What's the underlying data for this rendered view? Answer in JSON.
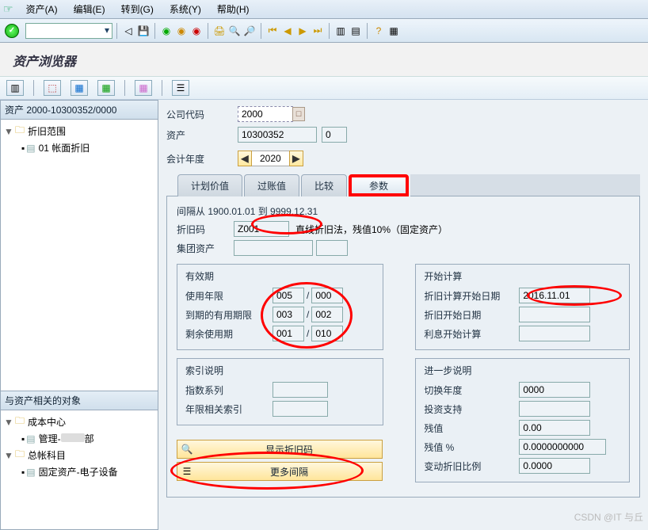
{
  "menubar": {
    "items": [
      {
        "label": "资产(A)"
      },
      {
        "label": "编辑(E)"
      },
      {
        "label": "转到(G)"
      },
      {
        "label": "系统(Y)"
      },
      {
        "label": "帮助(H)"
      }
    ]
  },
  "title": "资产浏览器",
  "left_tree": {
    "header": "资产 2000-10300352/0000",
    "root": {
      "label": "折旧范围"
    },
    "child": {
      "label": "01  帐面折旧"
    }
  },
  "left_tree2": {
    "header": "与资产相关的对象",
    "node1": {
      "label": "成本中心"
    },
    "node1_child": {
      "prefix": "管理-",
      "suffix": "部"
    },
    "node2": {
      "label": "总帐科目"
    },
    "node2_child": {
      "label": "固定资产-电子设备"
    }
  },
  "form": {
    "company_label": "公司代码",
    "company_value": "2000",
    "asset_label": "资产",
    "asset_value": "10300352",
    "asset_sub": "0",
    "fy_label": "会计年度",
    "fy_value": "2020"
  },
  "tabs": [
    {
      "label": "计划价值"
    },
    {
      "label": "过账值"
    },
    {
      "label": "比较"
    },
    {
      "label": "参数"
    }
  ],
  "panel": {
    "range": "间隔从 1900.01.01 到 9999.12.31",
    "depkey_label": "折旧码",
    "depkey_value": "Z001",
    "depkey_desc": "直线折旧法，残值10%（固定资产）",
    "group_label": "集团资产",
    "validity": {
      "title": "有效期",
      "useful_life_label": "使用年限",
      "useful_life_y": "005",
      "useful_life_m": "000",
      "expired_label": "到期的有用期限",
      "expired_y": "003",
      "expired_m": "002",
      "remain_label": "剩余使用期",
      "remain_y": "001",
      "remain_m": "010"
    },
    "index": {
      "title": "索引说明",
      "series_label": "指数系列",
      "aging_label": "年限相关索引"
    },
    "start": {
      "title": "开始计算",
      "calc_start_label": "折旧计算开始日期",
      "calc_start_value": "2016.11.01",
      "dep_start_label": "折旧开始日期",
      "int_start_label": "利息开始计算"
    },
    "further": {
      "title": "进一步说明",
      "change_year_label": "切换年度",
      "change_year_value": "0000",
      "invest_label": "投资支持",
      "scrap_label": "残值",
      "scrap_value": "0.00",
      "scrap_pct_label": "残值 %",
      "scrap_pct_value": "0.0000000000",
      "var_dep_label": "变动折旧比例",
      "var_dep_value": "0.0000"
    },
    "btn_show": "显示折旧码",
    "btn_more": "更多间隔"
  },
  "watermark": "CSDN @IT 与丘",
  "chart_data": null
}
